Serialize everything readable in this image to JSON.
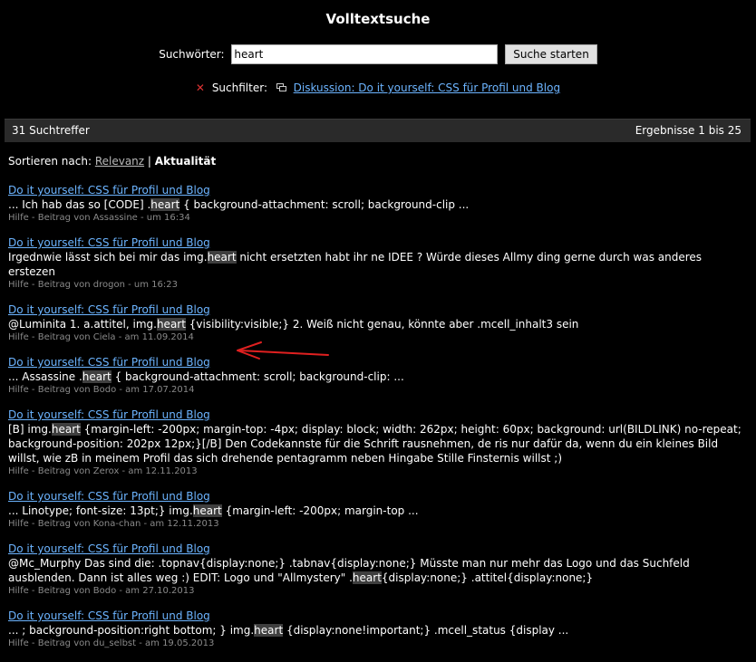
{
  "page": {
    "title": "Volltextsuche"
  },
  "search": {
    "label": "Suchwörter:",
    "value": "heart",
    "button": "Suche starten"
  },
  "filter": {
    "label": "Suchfilter:",
    "link": "Diskussion: Do it yourself: CSS für Profil und Blog"
  },
  "results_bar": {
    "count": "31 Suchtreffer",
    "range": "Ergebnisse 1 bis 25"
  },
  "sort": {
    "label": "Sortieren nach:",
    "option_relevance": "Relevanz",
    "separator": "|",
    "option_current": "Aktualität"
  },
  "results": [
    {
      "title": "Do it yourself: CSS für Profil und Blog",
      "snippet_before": "... Ich hab das so [CODE] .",
      "highlight": "heart",
      "snippet_after": " { background-attachment: scroll; background-clip ...",
      "meta": "Hilfe - Beitrag von Assassine - um 16:34"
    },
    {
      "title": "Do it yourself: CSS für Profil und Blog",
      "snippet_before": "Irgednwie lässt sich bei mir das img.",
      "highlight": "heart",
      "snippet_after": " nicht ersetzten habt ihr ne IDEE ? Würde dieses Allmy ding gerne durch was anderes erstezen",
      "meta": "Hilfe - Beitrag von drogon - um 16:23"
    },
    {
      "title": "Do it yourself: CSS für Profil und Blog",
      "snippet_before": "@Luminita 1. a.attitel, img.",
      "highlight": "heart",
      "snippet_after": " {visibility:visible;} 2. Weiß nicht genau, könnte aber .mcell_inhalt3 sein",
      "meta": "Hilfe - Beitrag von Ciela - am 11.09.2014"
    },
    {
      "title": "Do it yourself: CSS für Profil und Blog",
      "snippet_before": "... Assassine .",
      "highlight": "heart",
      "snippet_after": " { background-attachment: scroll; background-clip: ...",
      "meta": "Hilfe - Beitrag von Bodo - am 17.07.2014"
    },
    {
      "title": "Do it yourself: CSS für Profil und Blog",
      "snippet_before": "[B] img.",
      "highlight": "heart",
      "snippet_after": " {margin-left: -200px; margin-top: -4px; display: block; width: 262px; height: 60px; background: url(BILDLINK) no-repeat; background-position: 202px 12px;}[/B] Den Codekannste für die Schrift rausnehmen, de ris nur dafür da, wenn du ein kleines Bild willst, wie zB in meinem Profil das sich drehende pentagramm neben Hingabe Stille Finsternis willst ;)",
      "meta": "Hilfe - Beitrag von Zerox - am 12.11.2013"
    },
    {
      "title": "Do it yourself: CSS für Profil und Blog",
      "snippet_before": "... Linotype; font-size: 13pt;} img.",
      "highlight": "heart",
      "snippet_after": " {margin-left: -200px; margin-top ...",
      "meta": "Hilfe - Beitrag von Kona-chan - am 12.11.2013"
    },
    {
      "title": "Do it yourself: CSS für Profil und Blog",
      "snippet_before": "@Mc_Murphy Das sind die: .topnav{display:none;} .tabnav{display:none;} Müsste man nur mehr das Logo und das Suchfeld ausblenden. Dann ist alles weg :) EDIT: Logo und \"Allmystery\" .",
      "highlight": "heart",
      "snippet_after": "{display:none;} .attitel{display:none;}",
      "meta": "Hilfe - Beitrag von Bodo - am 27.10.2013"
    },
    {
      "title": "Do it yourself: CSS für Profil und Blog",
      "snippet_before": "... ; background-position:right bottom; } img.",
      "highlight": "heart",
      "snippet_after": " {display:none!important;} .mcell_status {display ...",
      "meta": "Hilfe - Beitrag von du_selbst - am 19.05.2013"
    }
  ],
  "colors": {
    "background": "#000000",
    "link": "#6cb4ff",
    "meta": "#8a8a8a",
    "bar": "#2a2a2a",
    "annotation_arrow": "#e02020"
  }
}
